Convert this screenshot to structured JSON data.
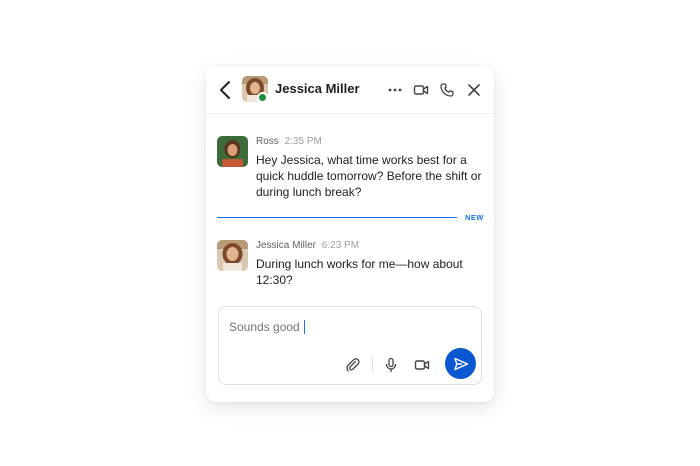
{
  "header": {
    "contact_name": "Jessica Miller",
    "presence": "online",
    "presence_color": "#1e8e3e",
    "icons": [
      "back-arrow-icon",
      "more-options-icon",
      "video-call-icon",
      "phone-call-icon",
      "close-icon"
    ]
  },
  "messages": [
    {
      "sender": "Ross",
      "time": "2:35 PM",
      "text": "Hey Jessica, what time works best for a quick huddle tomorrow? Before the shift or during lunch break?"
    },
    {
      "sender": "Jessica Miller",
      "time": "6:23 PM",
      "text": "During lunch works for me—how about 12:30?"
    }
  ],
  "divider": {
    "label": "NEW",
    "color": "#1a73e8"
  },
  "composer": {
    "draft": "Sounds good",
    "icons": [
      "attach-icon",
      "microphone-icon",
      "video-message-icon",
      "send-icon"
    ]
  },
  "colors": {
    "accent": "#0b57d0"
  }
}
